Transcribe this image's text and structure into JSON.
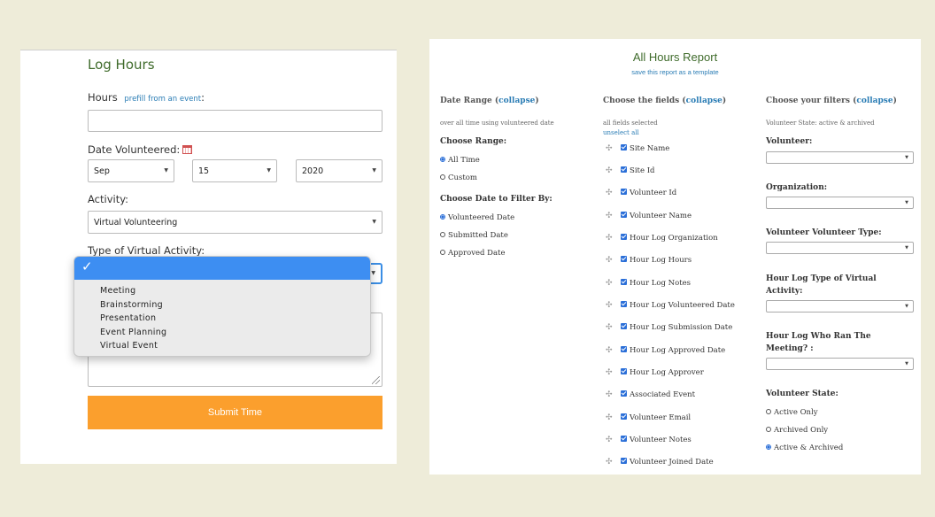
{
  "log_hours": {
    "title": "Log Hours",
    "hours_label": "Hours",
    "prefill_link": "prefill from an event",
    "hours_colon": ":",
    "hours_value": "",
    "date_label": "Date Volunteered:",
    "date_month": "Sep",
    "date_day": "15",
    "date_year": "2020",
    "activity_label": "Activity:",
    "activity_value": "Virtual Volunteering",
    "type_label": "Type of Virtual Activity:",
    "type_options": [
      "Meeting",
      "Brainstorming",
      "Presentation",
      "Event Planning",
      "Virtual Event"
    ],
    "selected_mark": "✓",
    "submit_label": "Submit Time"
  },
  "report": {
    "title": "All Hours Report",
    "save_template": "save this report as a template",
    "date_range": {
      "heading": "Date Range",
      "collapse": "collapse",
      "summary": "over all time using volunteered date",
      "choose_range_label": "Choose Range:",
      "ranges": [
        {
          "label": "All Time",
          "selected": true
        },
        {
          "label": "Custom",
          "selected": false
        }
      ],
      "filter_by_label": "Choose Date to Filter By:",
      "filter_by": [
        {
          "label": "Volunteered Date",
          "selected": true
        },
        {
          "label": "Submitted Date",
          "selected": false
        },
        {
          "label": "Approved Date",
          "selected": false
        }
      ]
    },
    "fields": {
      "heading": "Choose the fields",
      "collapse": "collapse",
      "summary": "all fields selected",
      "unselect_all": "unselect all",
      "items": [
        "Site Name",
        "Site Id",
        "Volunteer Id",
        "Volunteer Name",
        "Hour Log Organization",
        "Hour Log Hours",
        "Hour Log Notes",
        "Hour Log Volunteered Date",
        "Hour Log Submission Date",
        "Hour Log Approved Date",
        "Hour Log Approver",
        "Associated Event",
        "Volunteer Email",
        "Volunteer Notes",
        "Volunteer Joined Date"
      ]
    },
    "filters": {
      "heading": "Choose your filters",
      "collapse": "collapse",
      "summary": "Volunteer State: active & archived",
      "volunteer_label": "Volunteer:",
      "organization_label": "Organization:",
      "volunteer_type_label": "Volunteer Volunteer Type:",
      "virtual_activity_label_1": "Hour Log Type of Virtual",
      "virtual_activity_label_2": "Activity:",
      "who_ran_label_1": "Hour Log Who Ran The",
      "who_ran_label_2": "Meeting? :",
      "state_label": "Volunteer State:",
      "states": [
        {
          "label": "Active Only",
          "selected": false
        },
        {
          "label": "Archived Only",
          "selected": false
        },
        {
          "label": "Active & Archived",
          "selected": true
        }
      ]
    }
  }
}
